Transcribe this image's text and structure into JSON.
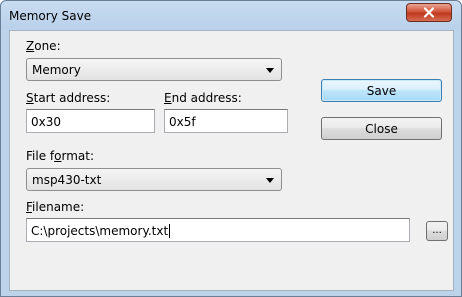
{
  "window": {
    "title": "Memory Save"
  },
  "zone": {
    "label_prefix": "",
    "label_accel": "Z",
    "label_rest": "one:",
    "value": "Memory"
  },
  "start_address": {
    "label_accel": "S",
    "label_rest": "tart address:",
    "value": "0x30"
  },
  "end_address": {
    "label_accel": "E",
    "label_rest": "nd address:",
    "value": "0x5f"
  },
  "file_format": {
    "label_pre": "File f",
    "label_accel": "o",
    "label_rest": "rmat:",
    "value": "msp430-txt"
  },
  "filename": {
    "label_accel": "F",
    "label_rest": "ilename:",
    "value": "C:\\projects\\memory.txt"
  },
  "buttons": {
    "save": "Save",
    "close": "Close",
    "browse": "..."
  },
  "icons": {
    "close": "close-icon",
    "dropdown": "chevron-down-icon"
  },
  "colors": {
    "titlebar": "#bcd3ea",
    "close_button": "#c0391f",
    "default_button_border": "#3c7fb1",
    "client_background": "#f0f0f0"
  }
}
